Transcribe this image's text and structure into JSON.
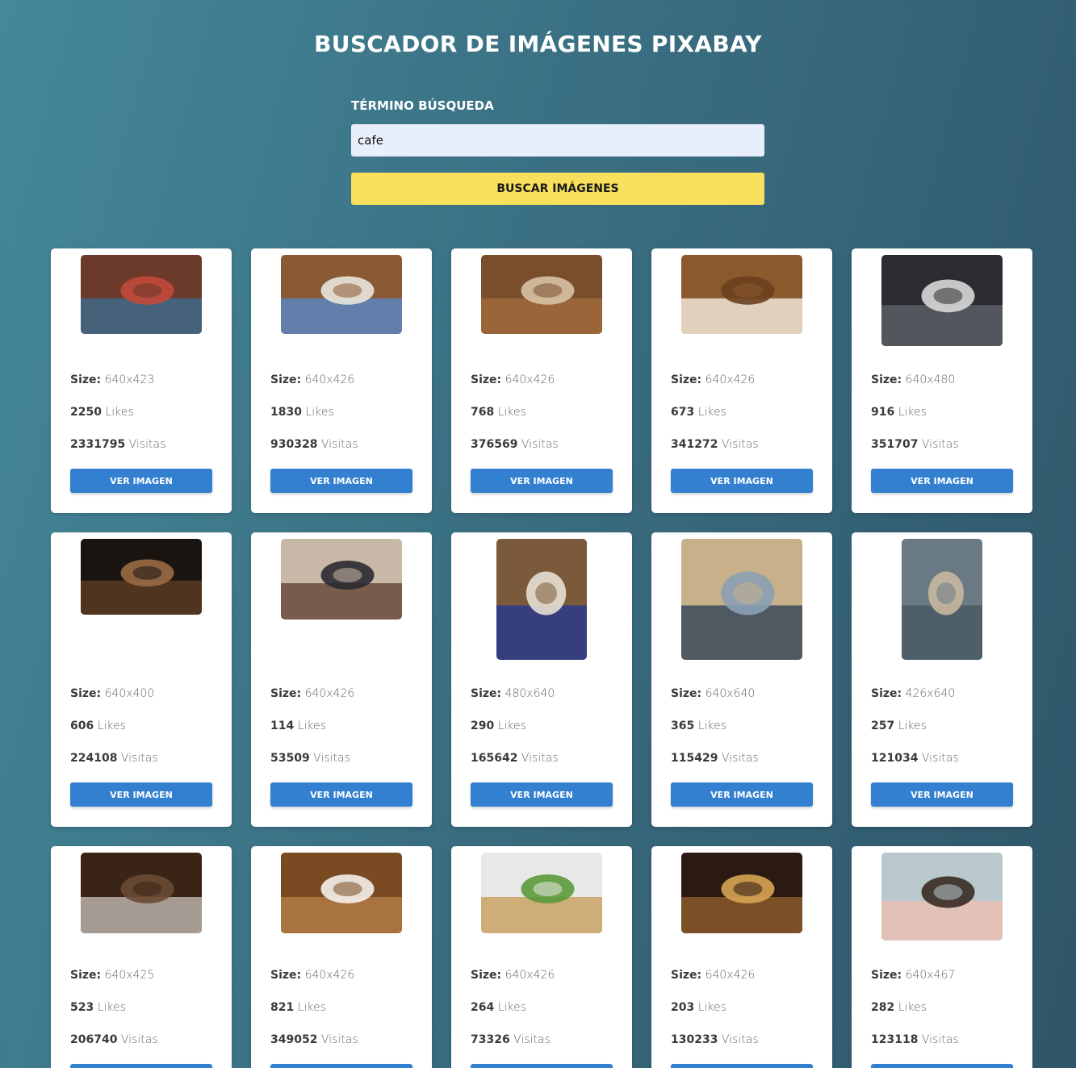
{
  "header": {
    "title": "BUSCADOR DE IMÁGENES PIXABAY"
  },
  "search": {
    "label": "TÉRMINO BÚSQUEDA",
    "value": "cafe",
    "button_label": "BUSCAR IMÁGENES"
  },
  "labels": {
    "size": "Size:",
    "likes": "Likes",
    "views": "Visitas",
    "view_button": "VER IMAGEN"
  },
  "results": [
    {
      "size": "640x423",
      "likes": "2250",
      "views": "2331795",
      "colors": [
        "#6b3a2a",
        "#3f6a8a",
        "#c24a3a"
      ]
    },
    {
      "size": "640x426",
      "likes": "1830",
      "views": "930328",
      "colors": [
        "#8a5a34",
        "#5a86c2",
        "#e9e6dc"
      ]
    },
    {
      "size": "640x426",
      "likes": "768",
      "views": "376569",
      "colors": [
        "#7a4e2c",
        "#a06a3c",
        "#d8c2a4"
      ]
    },
    {
      "size": "640x426",
      "likes": "673",
      "views": "341272",
      "colors": [
        "#8a5a2c",
        "#f0e6d6",
        "#6a3e1e"
      ]
    },
    {
      "size": "640x480",
      "likes": "916",
      "views": "351707",
      "colors": [
        "#2a2c30",
        "#5a5e64",
        "#d8d8d8"
      ]
    },
    {
      "size": "640x400",
      "likes": "606",
      "views": "224108",
      "colors": [
        "#1a1410",
        "#5a3a22",
        "#9a6a44"
      ]
    },
    {
      "size": "640x426",
      "likes": "114",
      "views": "53509",
      "colors": [
        "#c8b8a8",
        "#6a4a3a",
        "#2a2a30"
      ]
    },
    {
      "size": "480x640",
      "likes": "290",
      "views": "165642",
      "colors": [
        "#7a5a3a",
        "#2a3a8a",
        "#e8e0d4"
      ]
    },
    {
      "size": "640x640",
      "likes": "365",
      "views": "115429",
      "colors": [
        "#c8b08a",
        "#3a4a5a",
        "#8aa0b4"
      ]
    },
    {
      "size": "426x640",
      "likes": "257",
      "views": "121034",
      "colors": [
        "#6a7a84",
        "#4a5a64",
        "#c8b8a0"
      ]
    },
    {
      "size": "640x425",
      "likes": "523",
      "views": "206740",
      "colors": [
        "#3a2416",
        "#b8b0a8",
        "#6a4a34"
      ]
    },
    {
      "size": "640x426",
      "likes": "821",
      "views": "349052",
      "colors": [
        "#7a4a22",
        "#b07a44",
        "#f4f0ea"
      ]
    },
    {
      "size": "640x426",
      "likes": "264",
      "views": "73326",
      "colors": [
        "#e8e8e6",
        "#caa264",
        "#5a9a3a"
      ]
    },
    {
      "size": "640x426",
      "likes": "203",
      "views": "130233",
      "colors": [
        "#2a1a12",
        "#8a5a2a",
        "#d8a454"
      ]
    },
    {
      "size": "640x467",
      "likes": "282",
      "views": "123118",
      "colors": [
        "#b8c8cc",
        "#e8c0b4",
        "#3a2a24"
      ]
    }
  ]
}
